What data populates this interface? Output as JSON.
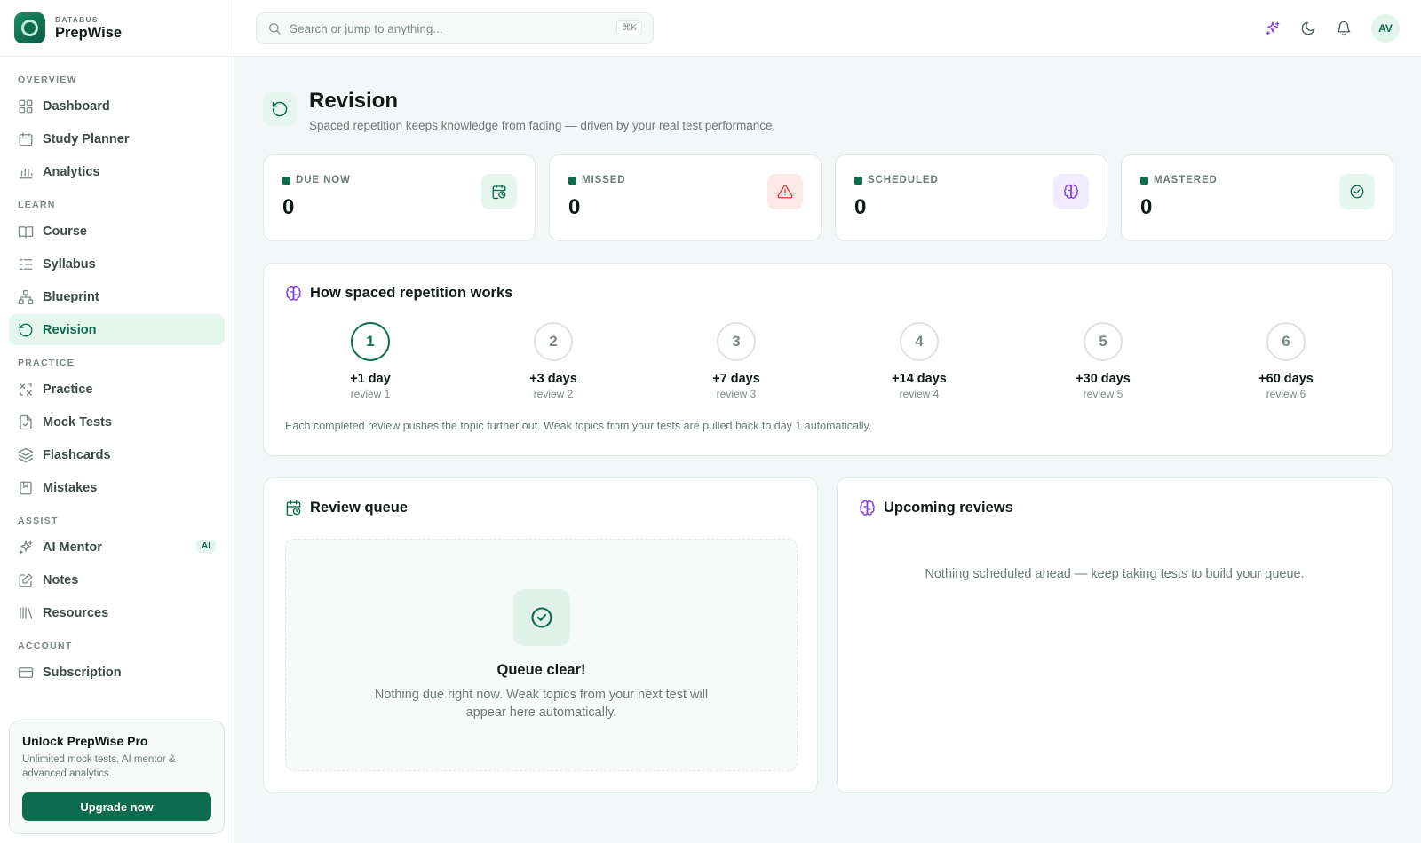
{
  "brand": {
    "kicker": "DATABUS",
    "name": "PrepWise"
  },
  "nav": {
    "overview_label": "OVERVIEW",
    "overview": [
      {
        "label": "Dashboard",
        "icon": "dashboard-icon"
      },
      {
        "label": "Study Planner",
        "icon": "calendar-icon"
      },
      {
        "label": "Analytics",
        "icon": "bar-chart-icon"
      }
    ],
    "learn_label": "LEARN",
    "learn": [
      {
        "label": "Course",
        "icon": "book-icon"
      },
      {
        "label": "Syllabus",
        "icon": "list-icon"
      },
      {
        "label": "Blueprint",
        "icon": "network-icon"
      },
      {
        "label": "Revision",
        "icon": "rotate-icon",
        "active": true
      }
    ],
    "practice_label": "PRACTICE",
    "practice": [
      {
        "label": "Practice",
        "icon": "practice-icon"
      },
      {
        "label": "Mock Tests",
        "icon": "clipboard-icon"
      },
      {
        "label": "Flashcards",
        "icon": "layers-icon"
      },
      {
        "label": "Mistakes",
        "icon": "bookmark-icon"
      }
    ],
    "assist_label": "ASSIST",
    "assist": [
      {
        "label": "AI Mentor",
        "icon": "sparkles-icon",
        "badge": "AI"
      },
      {
        "label": "Notes",
        "icon": "edit-icon"
      },
      {
        "label": "Resources",
        "icon": "library-icon"
      }
    ],
    "account_label": "ACCOUNT",
    "account": [
      {
        "label": "Subscription",
        "icon": "credit-card-icon"
      }
    ]
  },
  "promo": {
    "title": "Unlock PrepWise Pro",
    "text": "Unlimited mock tests, AI mentor & advanced analytics.",
    "button": "Upgrade now"
  },
  "topbar": {
    "search_placeholder": "Search or jump to anything...",
    "shortcut": "⌘K",
    "avatar": "AV"
  },
  "page": {
    "title": "Revision",
    "subtitle": "Spaced repetition keeps knowledge from fading — driven by your real test performance."
  },
  "stats": [
    {
      "label": "DUE NOW",
      "value": "0",
      "icon": "calendar-clock-icon",
      "bg": "#e6f6ef",
      "color": "#0c6b4c"
    },
    {
      "label": "MISSED",
      "value": "0",
      "icon": "alert-triangle-icon",
      "bg": "#fde8e8",
      "color": "#d1403a"
    },
    {
      "label": "SCHEDULED",
      "value": "0",
      "icon": "brain-icon",
      "bg": "#f0ebfd",
      "color": "#7c3aed"
    },
    {
      "label": "MASTERED",
      "value": "0",
      "icon": "check-circle-icon",
      "bg": "#e6f6ef",
      "color": "#0c6b4c"
    }
  ],
  "how": {
    "title": "How spaced repetition works",
    "steps": [
      {
        "num": "1",
        "days": "+1 day",
        "review": "review 1",
        "active": true
      },
      {
        "num": "2",
        "days": "+3 days",
        "review": "review 2"
      },
      {
        "num": "3",
        "days": "+7 days",
        "review": "review 3"
      },
      {
        "num": "4",
        "days": "+14 days",
        "review": "review 4"
      },
      {
        "num": "5",
        "days": "+30 days",
        "review": "review 5"
      },
      {
        "num": "6",
        "days": "+60 days",
        "review": "review 6"
      }
    ],
    "explain": "Each completed review pushes the topic further out. Weak topics from your tests are pulled back to day 1 automatically."
  },
  "queue": {
    "title": "Review queue",
    "empty_title": "Queue clear!",
    "empty_text": "Nothing due right now. Weak topics from your next test will appear here automatically."
  },
  "upcoming": {
    "title": "Upcoming reviews",
    "empty_text": "Nothing scheduled ahead — keep taking tests to build your queue."
  },
  "colors": {
    "brand": "#0e6b4d",
    "accent_purple": "#7c3aed",
    "danger": "#d1403a"
  }
}
